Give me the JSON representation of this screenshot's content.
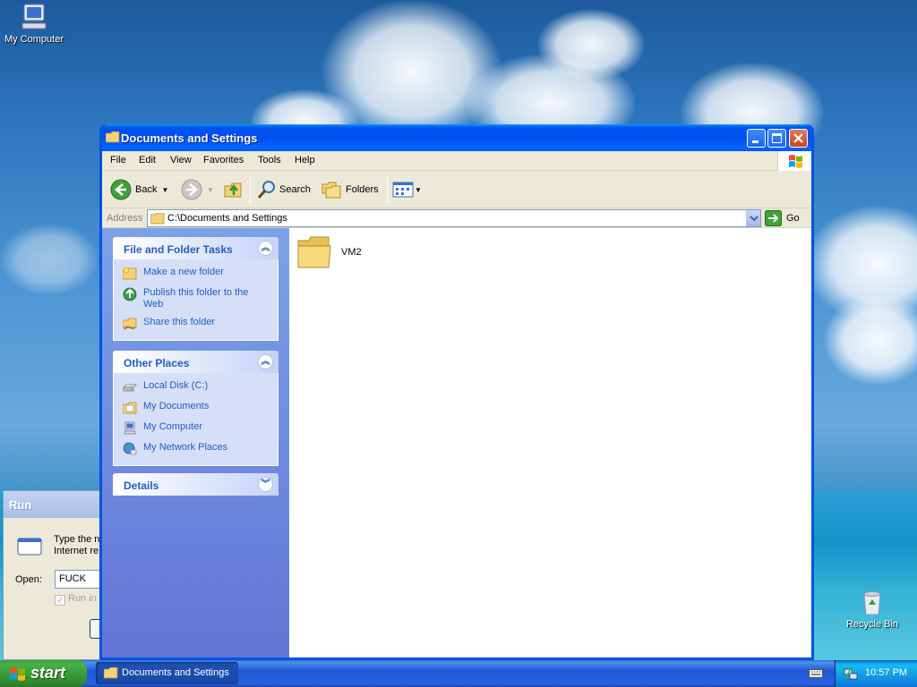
{
  "desktop": {
    "icons": [
      {
        "label": "My Computer"
      },
      {
        "label": "Recycle Bin"
      }
    ]
  },
  "run_dialog": {
    "title": "Run",
    "description_line1": "Type the n",
    "description_line2": "Internet re",
    "open_label": "Open:",
    "open_value": "FUCK",
    "checkbox_label": "Run in"
  },
  "window": {
    "title": "Documents and Settings",
    "menu": [
      "File",
      "Edit",
      "View",
      "Favorites",
      "Tools",
      "Help"
    ],
    "toolbar": {
      "back_label": "Back",
      "search_label": "Search",
      "folders_label": "Folders"
    },
    "address": {
      "label": "Address",
      "value": "C:\\Documents and Settings",
      "go_label": "Go"
    },
    "task_pane": {
      "file_tasks": {
        "title": "File and Folder Tasks",
        "links": [
          "Make a new folder",
          "Publish this folder to the Web",
          "Share this folder"
        ]
      },
      "other_places": {
        "title": "Other Places",
        "links": [
          "Local Disk (C:)",
          "My Documents",
          "My Computer",
          "My Network Places"
        ]
      },
      "details": {
        "title": "Details"
      }
    },
    "files": [
      {
        "name": "VM2",
        "type": "folder"
      }
    ]
  },
  "taskbar": {
    "start_label": "start",
    "task_button_label": "Documents and Settings",
    "clock": "10:57 PM"
  }
}
